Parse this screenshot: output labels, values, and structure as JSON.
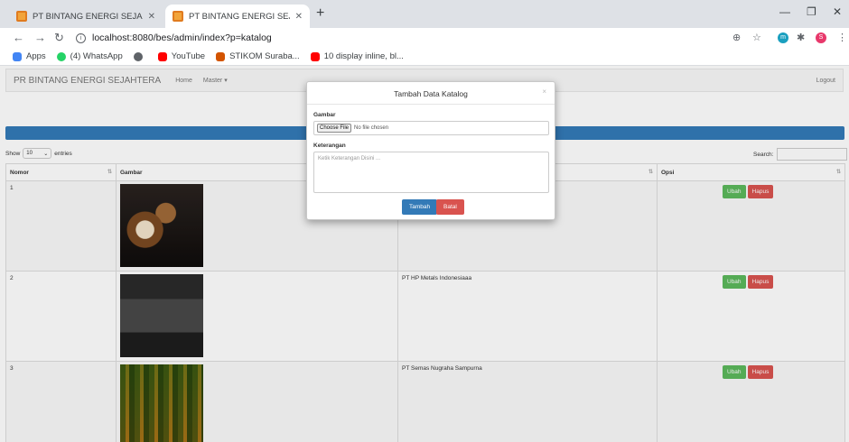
{
  "browser": {
    "tabs": [
      {
        "title": "PT BINTANG ENERGI SEJAHTERA"
      },
      {
        "title": "PT BINTANG ENERGI SEJAHTERA"
      }
    ],
    "url": "localhost:8080/bes/admin/index?p=katalog",
    "bookmarks": [
      {
        "label": "Apps",
        "color": "#4285f4"
      },
      {
        "label": "(4) WhatsApp",
        "color": "#25d366"
      },
      {
        "label": "",
        "color": "#5f6368"
      },
      {
        "label": "YouTube",
        "color": "#ff0000"
      },
      {
        "label": "STIKOM Suraba...",
        "color": "#d35400"
      },
      {
        "label": "10 display inline, bl...",
        "color": "#ff0000"
      }
    ],
    "profile_letter": "S",
    "ext_letter": "m"
  },
  "app": {
    "brand": "PR BINTANG ENERGI SEJAHTERA",
    "nav": {
      "home": "Home",
      "master": "Master ▾",
      "logout": "Logout"
    },
    "show_label": "Show",
    "entries_value": "10",
    "entries_label": "entries",
    "search_label": "Search:",
    "table": {
      "headers": [
        "Nomor",
        "Gambar",
        "",
        "Opsi"
      ],
      "rows": [
        {
          "nomor": "1",
          "keterangan": "",
          "ubah": "Ubah",
          "hapus": "Hapus"
        },
        {
          "nomor": "2",
          "keterangan": "PT HP Metals Indonesiaaa",
          "ubah": "Ubah",
          "hapus": "Hapus"
        },
        {
          "nomor": "3",
          "keterangan": "PT Semas Nugraha Sampurna",
          "ubah": "Ubah",
          "hapus": "Hapus"
        }
      ]
    }
  },
  "modal": {
    "title": "Tambah Data Katalog",
    "close": "×",
    "gambar_label": "Gambar",
    "choose_file": "Choose File",
    "no_file": "No file chosen",
    "keterangan_label": "Keterangan",
    "keterangan_placeholder": "Ketik Keterangan Disini ...",
    "submit": "Tambah",
    "cancel": "Batal"
  },
  "colors": {
    "primary": "#337ab7",
    "success": "#5cb85c",
    "danger": "#d9534f"
  }
}
